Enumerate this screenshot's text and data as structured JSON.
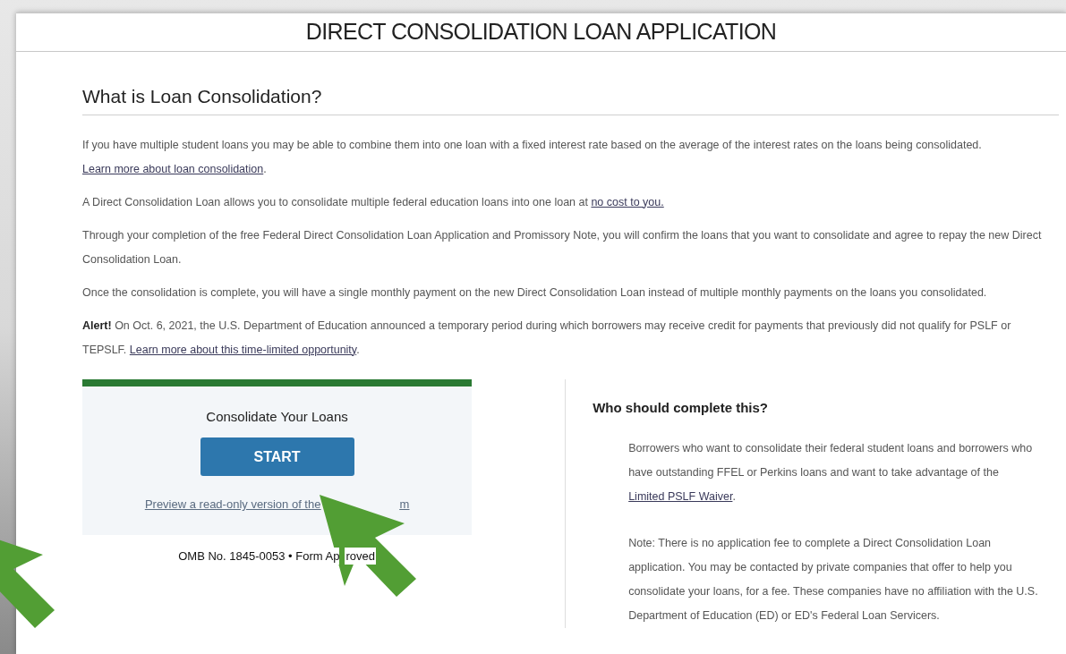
{
  "page_title": "DIRECT CONSOLIDATION LOAN APPLICATION",
  "section_heading": "What is Loan Consolidation?",
  "paragraphs": [
    [
      {
        "kind": "text",
        "text": "If you have multiple student loans you may be able to combine them into one loan with a fixed interest rate based on the average of the interest rates on the loans being consolidated. "
      },
      {
        "kind": "link",
        "text": "Learn more about loan consolidation"
      },
      {
        "kind": "text",
        "text": "."
      }
    ],
    [
      {
        "kind": "text",
        "text": "A Direct Consolidation Loan allows you to consolidate multiple federal education loans into one loan at "
      },
      {
        "kind": "link",
        "text": "no cost to you."
      }
    ],
    [
      {
        "kind": "text",
        "text": "Through your completion of the free Federal Direct Consolidation Loan Application and Promissory Note, you will confirm the loans that you want to consolidate and agree to repay the new Direct Consolidation Loan."
      }
    ],
    [
      {
        "kind": "text",
        "text": "Once the consolidation is complete, you will have a single monthly payment on the new Direct Consolidation Loan instead of multiple monthly payments on the loans you consolidated."
      }
    ],
    [
      {
        "kind": "bold",
        "text": "Alert!"
      },
      {
        "kind": "text",
        "text": " On Oct. 6, 2021, the U.S. Department of Education announced a temporary period during which borrowers may receive credit for payments that previously did not qualify for PSLF or TEPSLF. "
      },
      {
        "kind": "link",
        "text": "Learn more about this time-limited opportunity"
      },
      {
        "kind": "text",
        "text": "."
      }
    ]
  ],
  "card": {
    "title": "Consolidate Your Loans",
    "button": "START",
    "preview_link_parts": [
      "Preview a read-only version of the",
      "m"
    ],
    "omb_parts": [
      "OMB No. 1845-0053 • Form Ap",
      "roved"
    ]
  },
  "who": {
    "heading": "Who should complete this?",
    "paragraphs": [
      [
        {
          "kind": "text",
          "text": "Borrowers who want to consolidate their federal student loans and borrowers who have outstanding FFEL or Perkins loans and want to take advantage of the "
        },
        {
          "kind": "link",
          "text": "Limited PSLF Waiver"
        },
        {
          "kind": "text",
          "text": "."
        }
      ],
      [
        {
          "kind": "text",
          "text": "Note: There is no application fee to complete a Direct Consolidation Loan application. You may be contacted by private companies that offer to help you consolidate your loans, for a fee. These companies have no affiliation with the U.S. Department of Education (ED) or ED's Federal Loan Servicers."
        }
      ]
    ]
  }
}
